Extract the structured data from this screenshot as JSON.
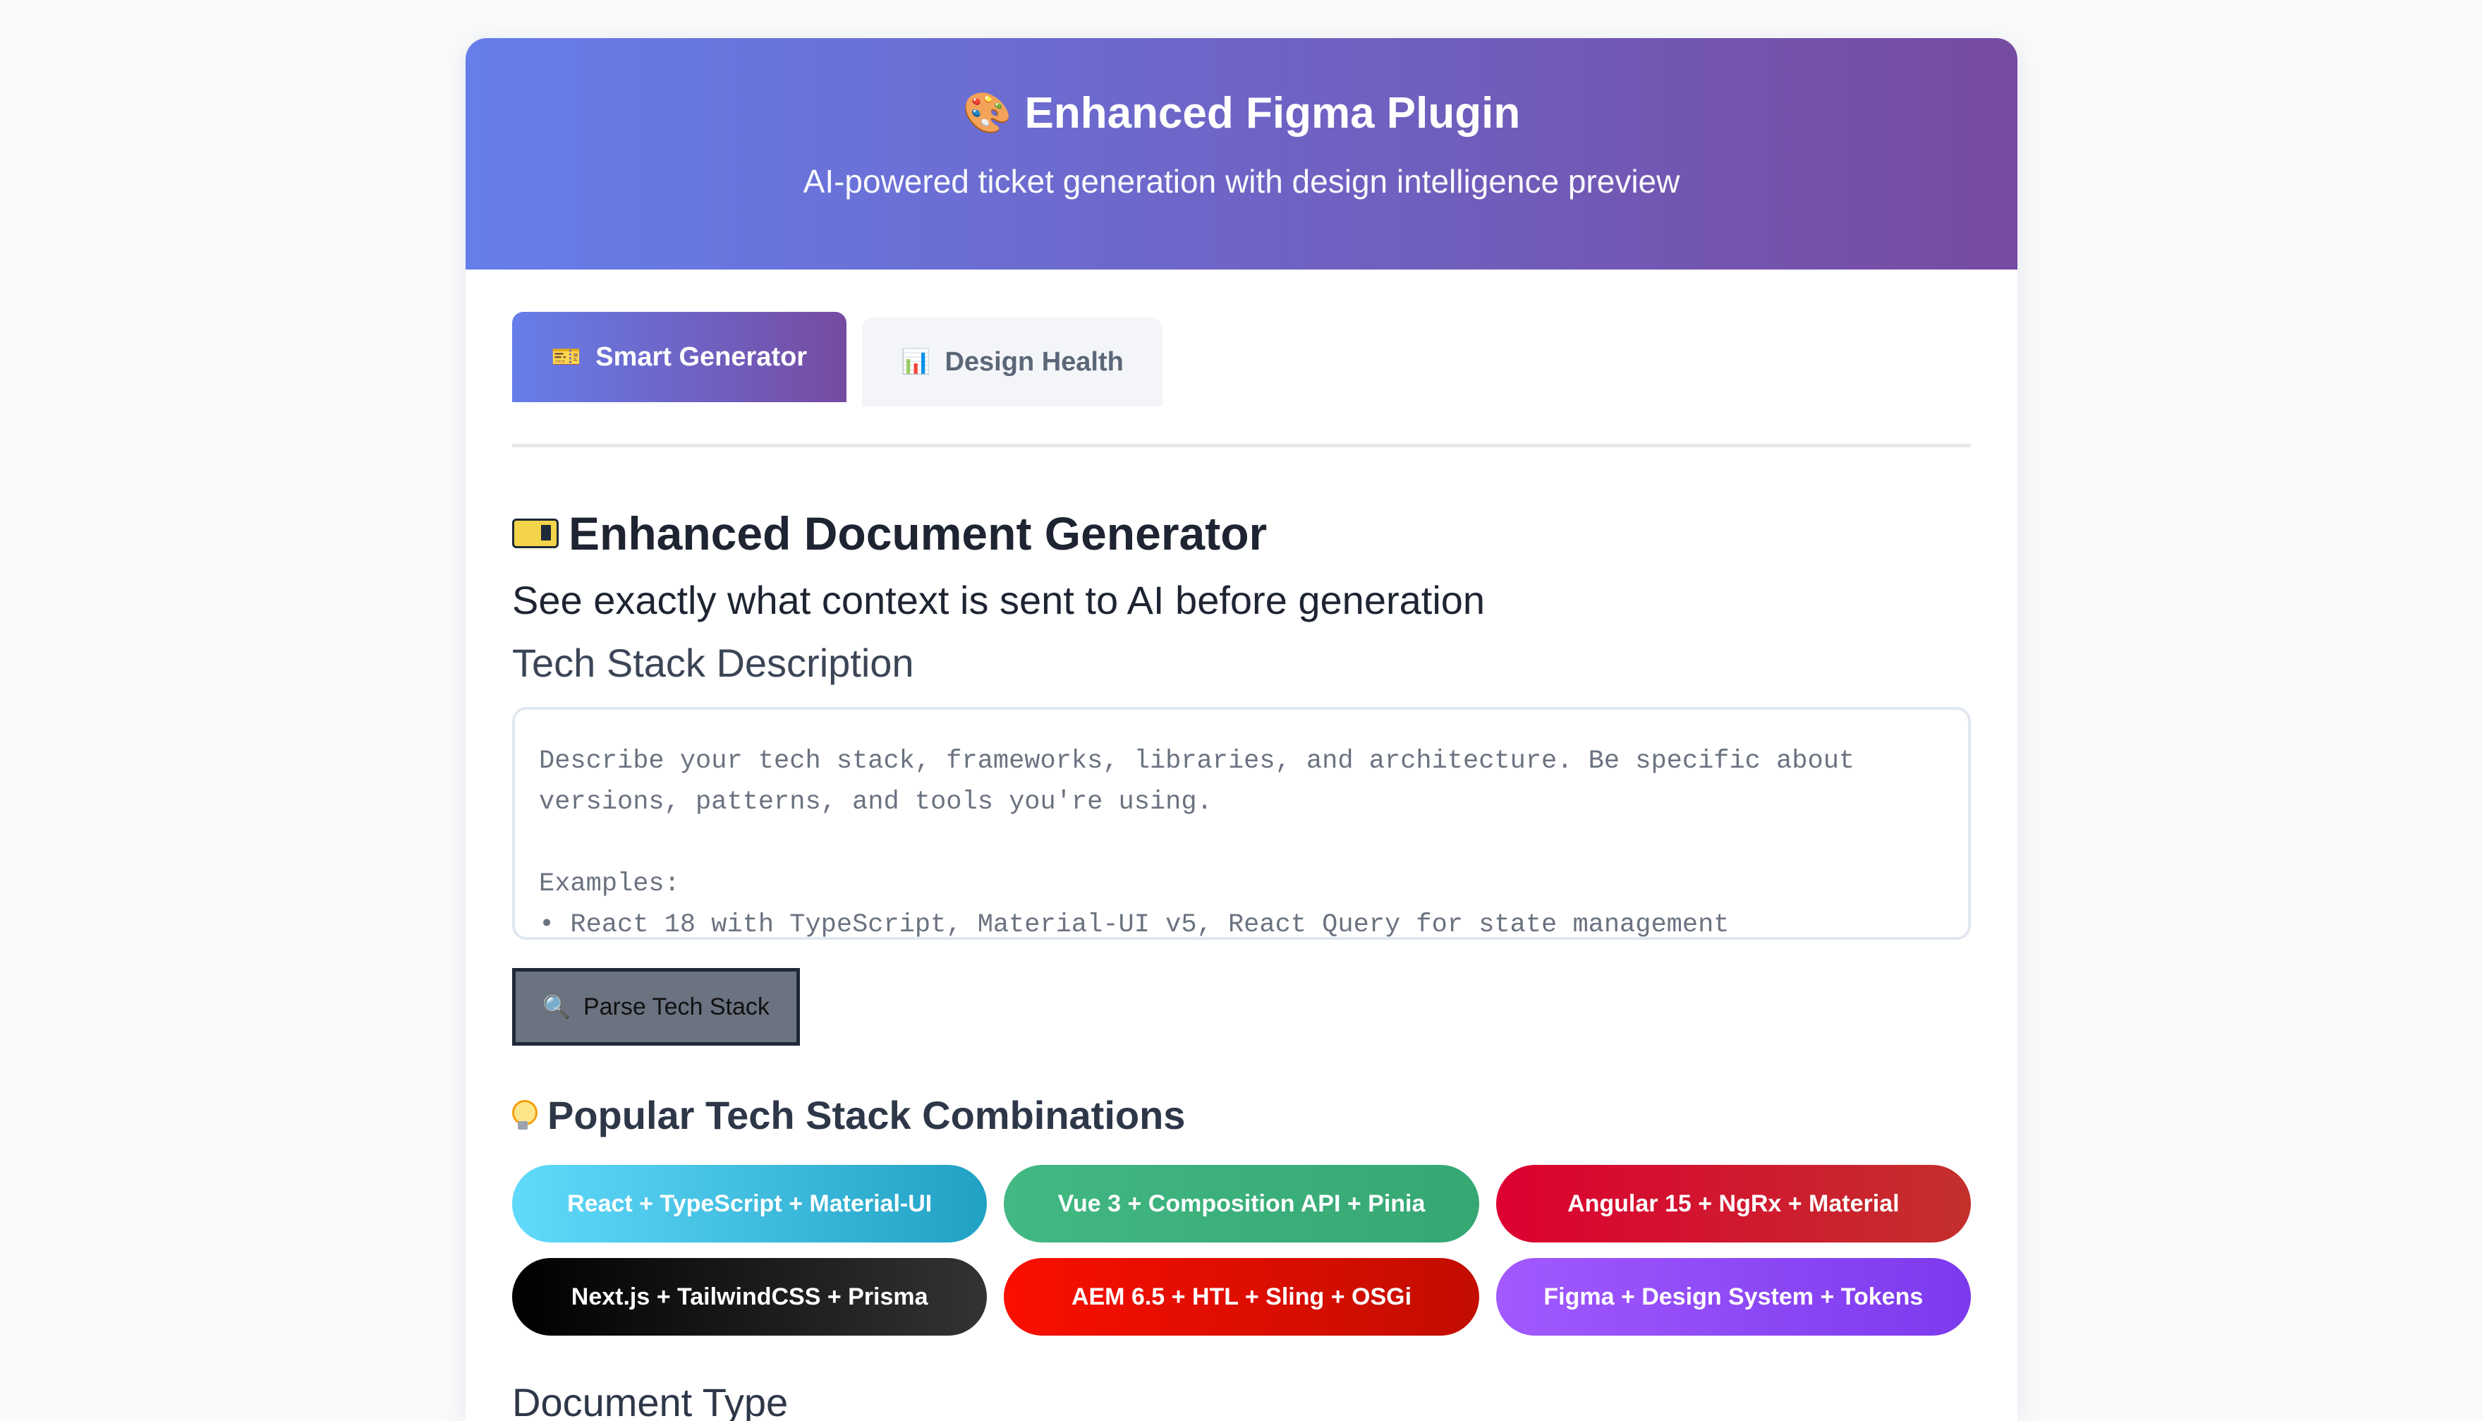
{
  "header": {
    "icon": "palette-icon",
    "title": "Enhanced Figma Plugin",
    "subtitle": "AI-powered ticket generation with design intelligence preview"
  },
  "tabs": [
    {
      "label": "Smart Generator",
      "icon": "ticket-icon",
      "active": true
    },
    {
      "label": "Design Health",
      "icon": "bar-chart-icon",
      "active": false
    }
  ],
  "generator": {
    "title": "Enhanced Document Generator",
    "subtitle": "See exactly what context is sent to AI before generation",
    "tech_stack_label": "Tech Stack Description",
    "tech_stack_placeholder": "Describe your tech stack, frameworks, libraries, and architecture. Be specific about versions, patterns, and tools you're using.\n\nExamples:\n• React 18 with TypeScript, Material-UI v5, React Query for state management",
    "parse_button": "Parse Tech Stack",
    "popular_title": "Popular Tech Stack Combinations",
    "combinations": [
      {
        "label": "React + TypeScript + Material-UI",
        "color": "#61dafb"
      },
      {
        "label": "Vue 3 + Composition API + Pinia",
        "color": "#42b883"
      },
      {
        "label": "Angular 15 + NgRx + Material",
        "color": "#dd0031"
      },
      {
        "label": "Next.js + TailwindCSS + Prisma",
        "color": "#000000"
      },
      {
        "label": "AEM 6.5 + HTL + Sling + OSGi",
        "color": "#fa0f00"
      },
      {
        "label": "Figma + Design System + Tokens",
        "color": "#a259ff"
      }
    ],
    "document_type_label": "Document Type"
  },
  "colors": {
    "header_gradient_start": "#667eea",
    "header_gradient_end": "#764ba2"
  }
}
